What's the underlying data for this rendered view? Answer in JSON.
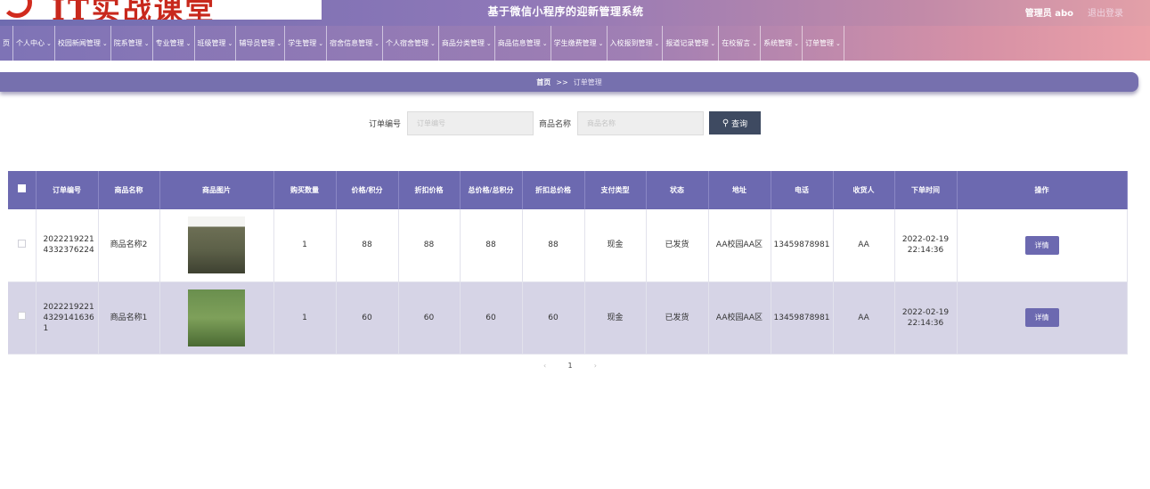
{
  "header": {
    "logo_text": "IT实战课堂",
    "system_title": "基于微信小程序的迎新管理系统",
    "user": "管理员 abo",
    "logout": "退出登录"
  },
  "nav": [
    {
      "label": "页",
      "chev": ""
    },
    {
      "label": "个人中心",
      "chev": "⌄"
    },
    {
      "label": "校园新闻管理",
      "chev": "⌄"
    },
    {
      "label": "院系管理",
      "chev": "⌄"
    },
    {
      "label": "专业管理",
      "chev": "⌄"
    },
    {
      "label": "班级管理",
      "chev": "⌄"
    },
    {
      "label": "辅导员管理",
      "chev": "⌄"
    },
    {
      "label": "学生管理",
      "chev": "⌄"
    },
    {
      "label": "宿舍信息管理",
      "chev": "⌄"
    },
    {
      "label": "个人宿舍管理",
      "chev": "⌄"
    },
    {
      "label": "商品分类管理",
      "chev": "⌄"
    },
    {
      "label": "商品信息管理",
      "chev": "⌄"
    },
    {
      "label": "学生缴费管理",
      "chev": "⌄"
    },
    {
      "label": "入校报到管理",
      "chev": "⌄"
    },
    {
      "label": "报道记录管理",
      "chev": "⌄"
    },
    {
      "label": "在校留言",
      "chev": "⌄"
    },
    {
      "label": "系统管理",
      "chev": "⌄"
    },
    {
      "label": "订单管理",
      "chev": "⌄"
    }
  ],
  "breadcrumb": {
    "home": "首页",
    "sep": ">>",
    "current": "订单管理"
  },
  "search": {
    "order_label": "订单编号",
    "order_placeholder": "订单编号",
    "product_label": "商品名称",
    "product_placeholder": "商品名称",
    "button_icon": "search-icon",
    "button_label": "查询"
  },
  "table": {
    "columns": [
      "订单编号",
      "商品名称",
      "商品图片",
      "购买数量",
      "价格/积分",
      "折扣价格",
      "总价格/总积分",
      "折扣总价格",
      "支付类型",
      "状态",
      "地址",
      "电话",
      "收货人",
      "下单时间",
      "操作"
    ],
    "rows": [
      {
        "order_no": "20222192214332376224",
        "name": "商品名称2",
        "image": "camouflage-uniform-photo",
        "qty": "1",
        "price": "88",
        "discount_price": "88",
        "total": "88",
        "discount_total": "88",
        "pay_type": "现金",
        "status": "已发货",
        "address": "AA校园AA区",
        "phone": "13459878981",
        "receiver": "AA",
        "time": "2022-02-19 22:14:36",
        "action": "详情"
      },
      {
        "order_no": "202221922143291416361",
        "name": "商品名称1",
        "image": "camouflage-shoes-photo",
        "qty": "1",
        "price": "60",
        "discount_price": "60",
        "total": "60",
        "discount_total": "60",
        "pay_type": "现金",
        "status": "已发货",
        "address": "AA校园AA区",
        "phone": "13459878981",
        "receiver": "AA",
        "time": "2022-02-19 22:14:36",
        "action": "详情"
      }
    ]
  },
  "pager": {
    "prev": "‹",
    "page": "1",
    "next": "›"
  }
}
